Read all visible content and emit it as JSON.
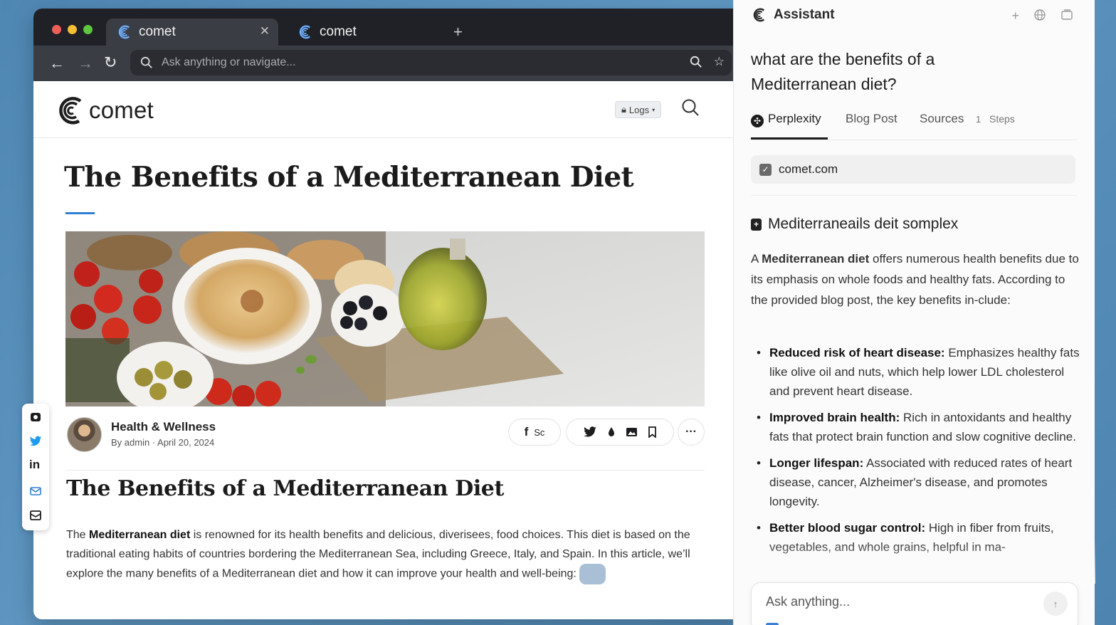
{
  "browser": {
    "tabs": [
      {
        "label": "comet",
        "active": true
      },
      {
        "label": "comet",
        "active": false
      }
    ],
    "address_placeholder": "Ask anything or navigate..."
  },
  "site": {
    "logo_text": "comet",
    "logs_label": "Logs",
    "article": {
      "title": "The Benefits of a Mediterranean Diet",
      "author_name": "Health & Wellness",
      "author_meta": "By admin · April 20, 2024",
      "share_label": "Sc",
      "subtitle": "The Benefits of a Mediterranean Diet",
      "body_pre": "The ",
      "body_bold": "Mediterranean diet",
      "body_post": " is renowned for its health benefits and delicious, diverisees, food choices. This diet is based on the traditional eating habits of countries bordering the Mediterranean Sea, including Greece, Italy, and Spain. In this article, we’ll explore the many benefits of a Mediterranean diet and how it can improve your health and well-being: "
    }
  },
  "assistant": {
    "title": "Assistant",
    "question": "what are the benefits of a Mediterranean diet?",
    "tabs": {
      "perplexity": "Perplexity",
      "blog_post": "Blog Post",
      "sources": "Sources",
      "sources_count": "1",
      "steps": "Steps"
    },
    "source_chip": "comet.com",
    "answer_heading": "Mediterraneails deit somplex",
    "intro_pre": "A ",
    "intro_bold": "Mediterranean diet",
    "intro_post": " offers numerous health benefits due to its emphasis on whole foods and healthy fats. According to the provided blog post, the key benefits in-clude:",
    "benefits": [
      {
        "title": "Reduced risk of heart disease:",
        "text": " Emphasizes healthy fats like olive oil and nuts, which help lower LDL cholesterol and prevent heart disease."
      },
      {
        "title": "Improved brain health:",
        "text": " Rich in antoxidants and healthy fats that protect brain function and slow cognitive decline."
      },
      {
        "title": "Longer lifespan:",
        "text": " Associated with reduced rates of heart disease, cancer, Alzheimer's disease, and promotes longevity."
      },
      {
        "title": "Better blood sugar control:",
        "text": " High in fiber from fruits, vegetables, and whole grains, helpful in ma-"
      }
    ],
    "ask_placeholder": "Ask anything..."
  },
  "colors": {
    "accent_blue": "#2f7fd3",
    "tab_bar": "#1f2126",
    "toolbar": "#3a3d43"
  }
}
